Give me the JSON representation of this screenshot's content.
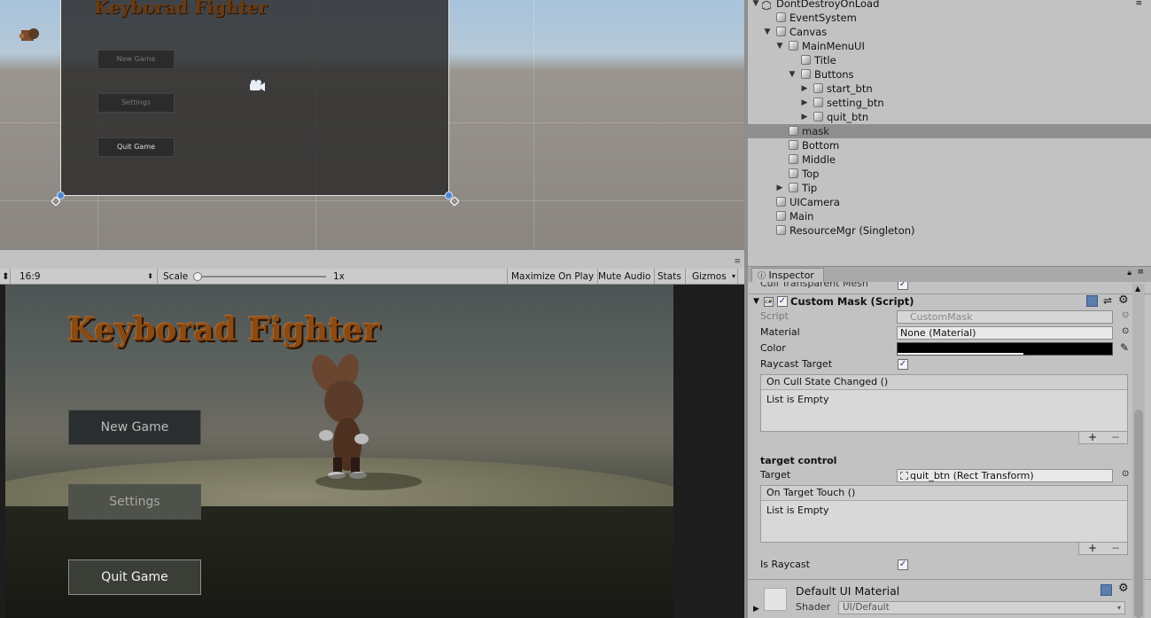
{
  "scene": {
    "title": "Keyborad Fighter",
    "buttons": [
      "New Game",
      "Settings",
      "Quit Game"
    ]
  },
  "game_toolbar": {
    "aspect": "16:9",
    "scale_label": "Scale",
    "scale_value": "1x",
    "maximize": "Maximize On Play",
    "mute": "Mute Audio",
    "stats": "Stats",
    "gizmos": "Gizmos"
  },
  "game": {
    "title": "Keyborad Fighter",
    "buttons": [
      "New Game",
      "Settings",
      "Quit Game"
    ]
  },
  "hierarchy": {
    "items": [
      {
        "label": "DontDestroyOnLoad"
      },
      {
        "label": "EventSystem"
      },
      {
        "label": "Canvas"
      },
      {
        "label": "MainMenuUI"
      },
      {
        "label": "Title"
      },
      {
        "label": "Buttons"
      },
      {
        "label": "start_btn"
      },
      {
        "label": "setting_btn"
      },
      {
        "label": "quit_btn"
      },
      {
        "label": "mask"
      },
      {
        "label": "Bottom"
      },
      {
        "label": "Middle"
      },
      {
        "label": "Top"
      },
      {
        "label": "Tip"
      },
      {
        "label": "UICamera"
      },
      {
        "label": "Main"
      },
      {
        "label": "ResourceMgr (Singleton)"
      }
    ]
  },
  "inspector": {
    "tab_label": "Inspector",
    "cut_row": "Cull Transparent Mesh",
    "component_title": "Custom Mask (Script)",
    "script_label": "Script",
    "script_value": "CustomMask",
    "material_label": "Material",
    "material_value": "None (Material)",
    "color_label": "Color",
    "raycast_label": "Raycast Target",
    "on_cull_label": "On Cull State Changed ()",
    "list_empty": "List is Empty",
    "section_header": "target control",
    "target_label": "Target",
    "target_value": "quit_btn (Rect Transform)",
    "on_target_label": "On Target Touch ()",
    "list_empty2": "List is Empty",
    "is_raycast_label": "Is Raycast",
    "default_material": "Default UI Material",
    "shader_label": "Shader",
    "shader_value": "UI/Default",
    "plus": "+",
    "minus": "−"
  }
}
